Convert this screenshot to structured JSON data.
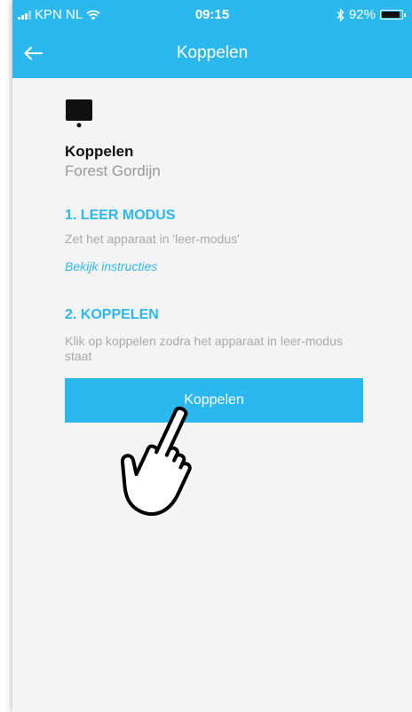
{
  "status_bar": {
    "carrier": "KPN NL",
    "time": "09:15",
    "battery": "92%",
    "battery_level": 0.92
  },
  "header": {
    "back_icon": "arrow-left-icon",
    "title": "Koppelen"
  },
  "device": {
    "icon": "device-screen-icon",
    "title": "Koppelen",
    "name": "Forest Gordijn"
  },
  "steps": [
    {
      "heading": "1. LEER MODUS",
      "text": "Zet het apparaat in 'leer-modus'",
      "link": "Bekijk instructies"
    },
    {
      "heading": "2. KOPPELEN",
      "text": "Klik op koppelen zodra het apparaat in leer-modus staat"
    }
  ],
  "pair_button": {
    "label": "Koppelen"
  },
  "overlay": {
    "icon": "hand-pointer-icon"
  },
  "colors": {
    "accent": "#2bb8ef",
    "background": "#f4f4f4",
    "muted_text": "#a9a9a9"
  }
}
